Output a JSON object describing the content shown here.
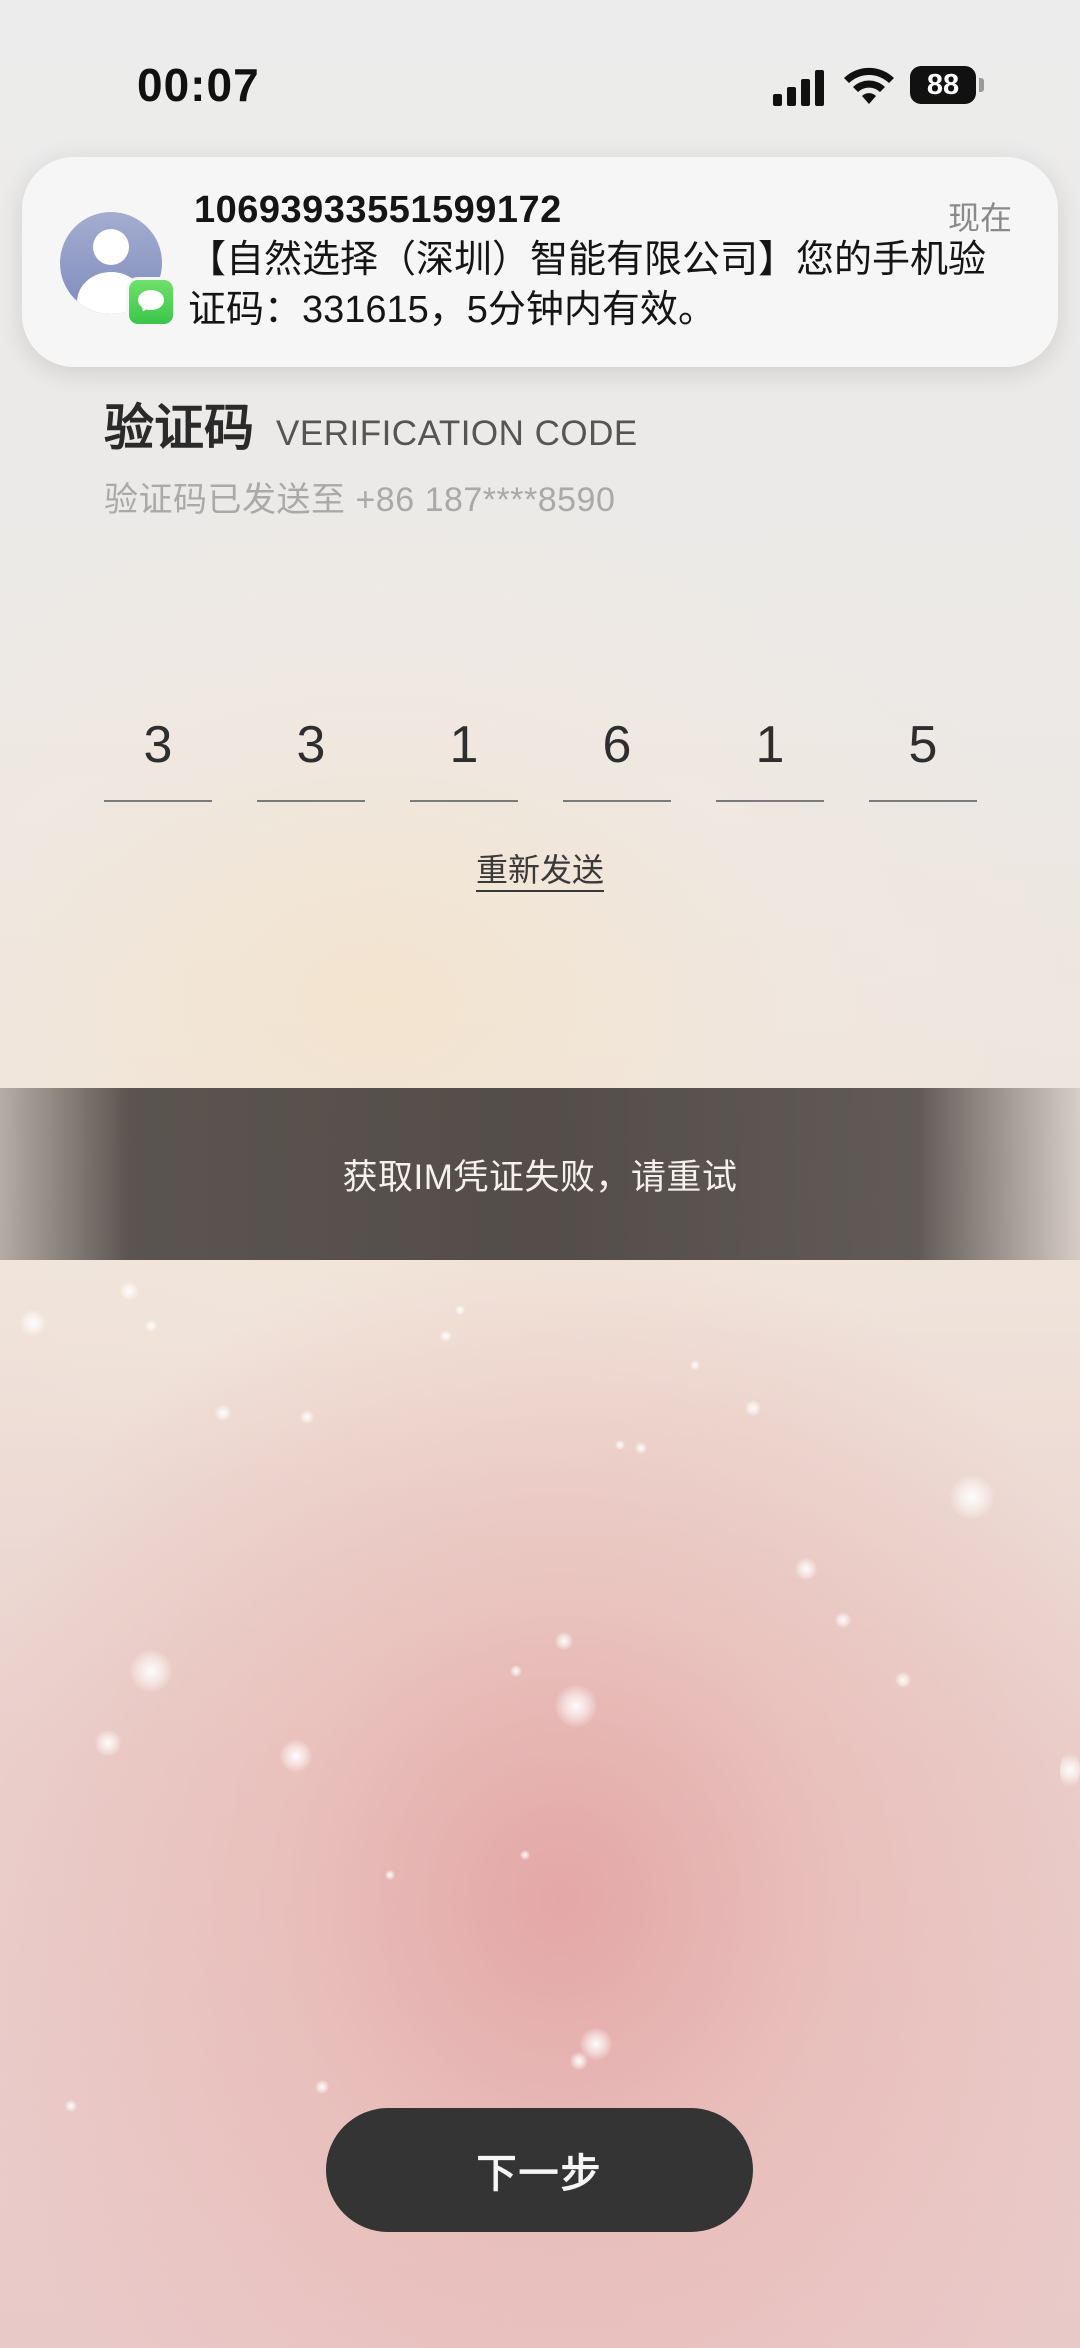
{
  "status_bar": {
    "time": "00:07",
    "battery_level": "88",
    "icons": [
      "signal-icon",
      "wifi-icon",
      "battery-icon"
    ]
  },
  "notification": {
    "sender": "10693933551599172",
    "time": "现在",
    "body": "【自然选择（深圳）智能有限公司】您的手机验证码：331615，5分钟内有效。",
    "icons": [
      "contact-avatar-icon",
      "messages-app-icon"
    ]
  },
  "header": {
    "title": "验证码",
    "subtitle": "VERIFICATION CODE",
    "sent_to": "验证码已发送至 +86 187****8590"
  },
  "code": {
    "digits": [
      "3",
      "3",
      "1",
      "6",
      "1",
      "5"
    ]
  },
  "resend_label": "重新发送",
  "toast": {
    "message": "获取IM凭证失败，请重试"
  },
  "next_button_label": "下一步",
  "colors": {
    "button_bg": "#343434",
    "toast_bg": "#46403d",
    "accent_green": "#3bc64a"
  }
}
